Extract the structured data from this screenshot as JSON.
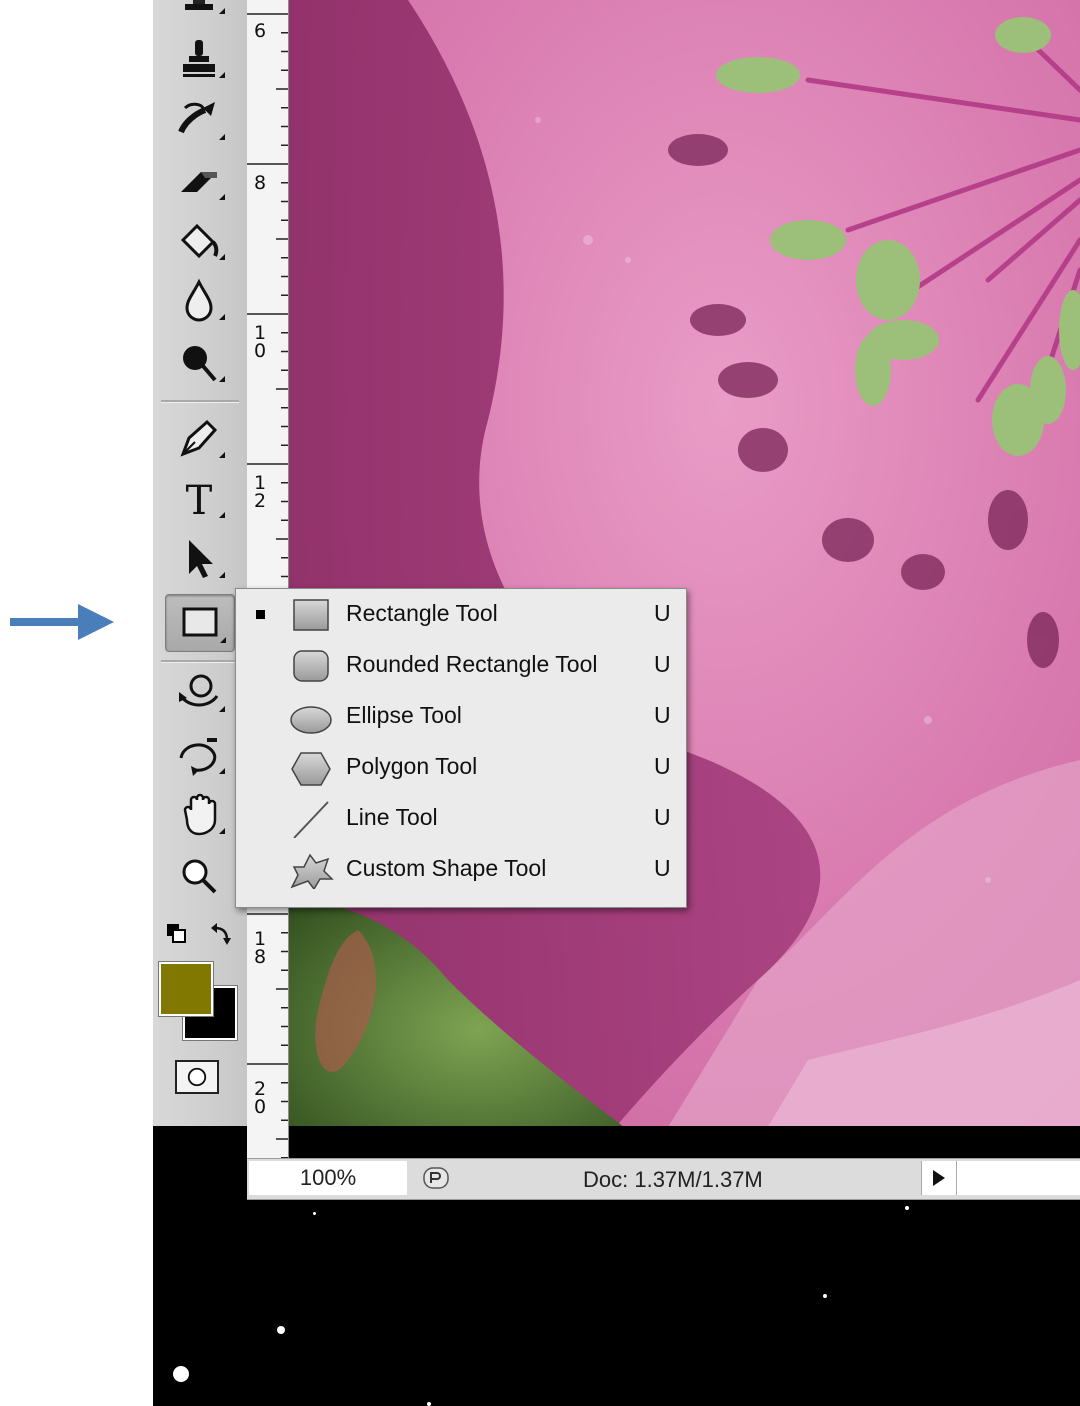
{
  "annotation": {
    "pointer_color": "#4a7ebb"
  },
  "toolbar": {
    "tools": [
      {
        "name": "clone-stamp-tool-icon"
      },
      {
        "name": "history-brush-tool-icon"
      },
      {
        "name": "eraser-tool-icon"
      },
      {
        "name": "paint-bucket-tool-icon"
      },
      {
        "name": "blur-tool-icon"
      },
      {
        "name": "dodge-tool-icon"
      },
      {
        "name": "pen-tool-icon"
      },
      {
        "name": "type-tool-icon",
        "glyph": "T"
      },
      {
        "name": "path-selection-tool-icon"
      },
      {
        "name": "rectangle-tool-icon",
        "active": true
      },
      {
        "name": "3d-rotate-tool-icon"
      },
      {
        "name": "3d-orbit-tool-icon"
      },
      {
        "name": "hand-tool-icon"
      },
      {
        "name": "zoom-tool-icon"
      }
    ],
    "foreground_color": "#807800",
    "background_color": "#000000"
  },
  "ruler": {
    "labels": [
      "6",
      "8",
      "1\n0",
      "1\n2",
      "1\n8",
      "2\n0"
    ]
  },
  "shape_menu": {
    "items": [
      {
        "label": "Rectangle Tool",
        "shortcut": "U",
        "selected": true,
        "icon": "rectangle-shape-icon"
      },
      {
        "label": "Rounded Rectangle Tool",
        "shortcut": "U",
        "selected": false,
        "icon": "rounded-rectangle-shape-icon"
      },
      {
        "label": "Ellipse Tool",
        "shortcut": "U",
        "selected": false,
        "icon": "ellipse-shape-icon"
      },
      {
        "label": "Polygon Tool",
        "shortcut": "U",
        "selected": false,
        "icon": "polygon-shape-icon"
      },
      {
        "label": "Line Tool",
        "shortcut": "U",
        "selected": false,
        "icon": "line-shape-icon"
      },
      {
        "label": "Custom Shape Tool",
        "shortcut": "U",
        "selected": false,
        "icon": "custom-shape-icon"
      }
    ]
  },
  "status_bar": {
    "zoom": "100%",
    "doc_info": "Doc: 1.37M/1.37M"
  }
}
